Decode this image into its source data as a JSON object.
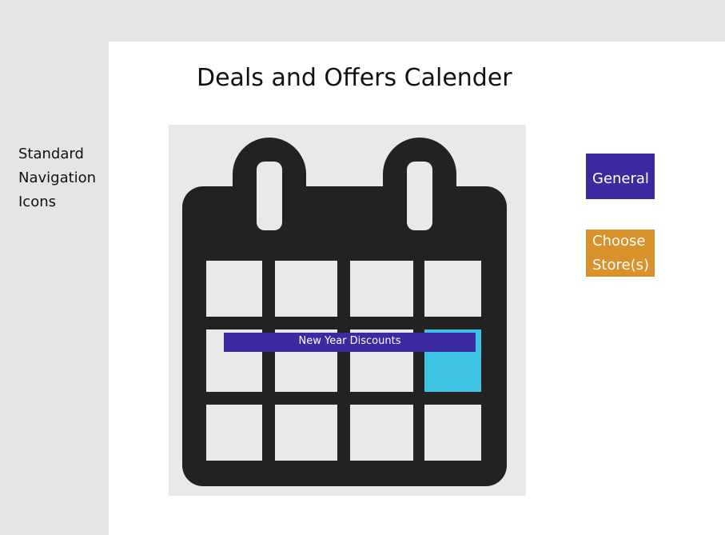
{
  "sidebar": {
    "label_lines": [
      "Standard",
      "Navigation",
      "Icons"
    ]
  },
  "main": {
    "title": "Deals and Offers Calender"
  },
  "calendar": {
    "icon": "calendar-icon",
    "event": {
      "label": "New Year Discounts"
    },
    "rows": 3,
    "columns": 4,
    "highlighted_cell": {
      "row": 2,
      "column": 4
    }
  },
  "actions": {
    "general_label": "General",
    "choose_store_lines": [
      "Choose",
      "Store(s)"
    ]
  },
  "colors": {
    "page_bg": "#e5e5e5",
    "panel_bg": "#ffffff",
    "calendar_dark": "#222222",
    "calendar_cell": "#e9e9e9",
    "highlight_cell": "#3ec3e4",
    "event_bar": "#3b2aa0",
    "general_button": "#3b2aa0",
    "store_button": "#d8912b"
  }
}
